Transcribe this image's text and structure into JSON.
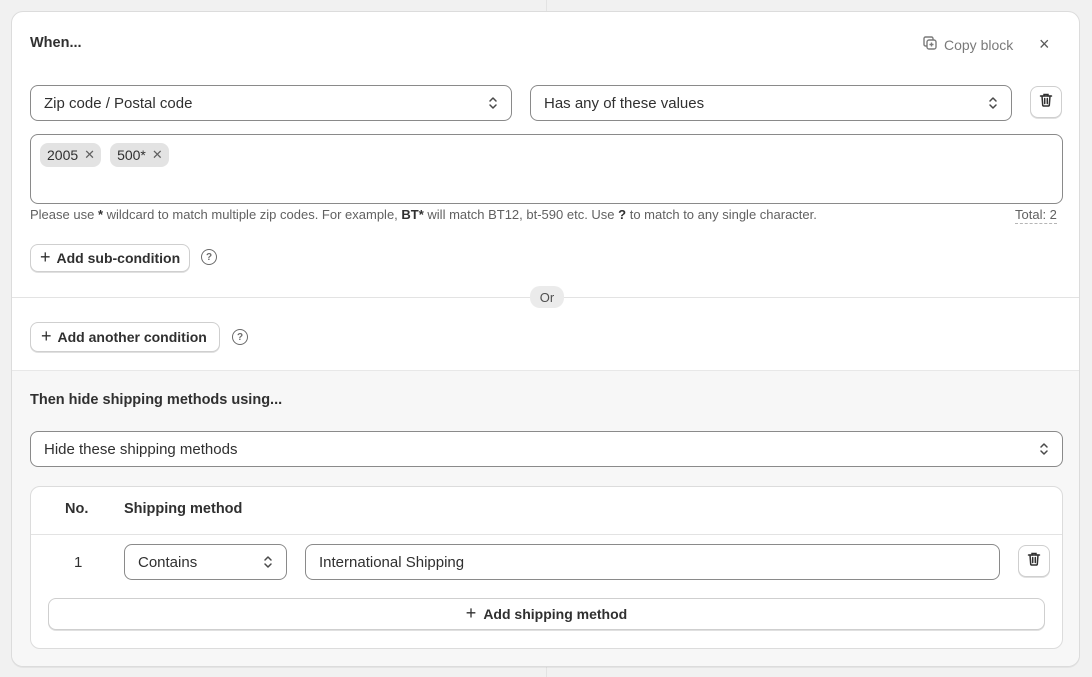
{
  "when": {
    "title": "When...",
    "copy_block_label": "Copy block",
    "close_glyph": "×",
    "condition_field": "Zip code / Postal code",
    "condition_operator": "Has any of these values",
    "values": [
      {
        "label": "2005"
      },
      {
        "label": "500*"
      }
    ],
    "help": {
      "part1": "Please use ",
      "wildcard": "*",
      "part2": " wildcard to match multiple zip codes. For example, ",
      "example": "BT*",
      "part3": " will match BT12, bt-590 etc. Use ",
      "single": "?",
      "part4": " to match to any single character."
    },
    "total_label": "Total: 2",
    "add_subcondition_label": "Add sub-condition",
    "or_label": "Or",
    "add_condition_label": "Add another condition"
  },
  "then": {
    "title": "Then hide shipping methods using...",
    "action_select": "Hide these shipping methods",
    "table": {
      "col_no": "No.",
      "col_method": "Shipping method",
      "rows": [
        {
          "no": "1",
          "match": "Contains",
          "value": "International Shipping"
        }
      ]
    },
    "add_method_label": "Add shipping method"
  },
  "icons": {
    "copy": "copy-icon",
    "close": "close-icon",
    "select": "select-chevrons-icon",
    "delete": "trash-icon",
    "tag_remove": "x-icon",
    "plus": "plus-icon",
    "help": "question-circle-icon"
  }
}
